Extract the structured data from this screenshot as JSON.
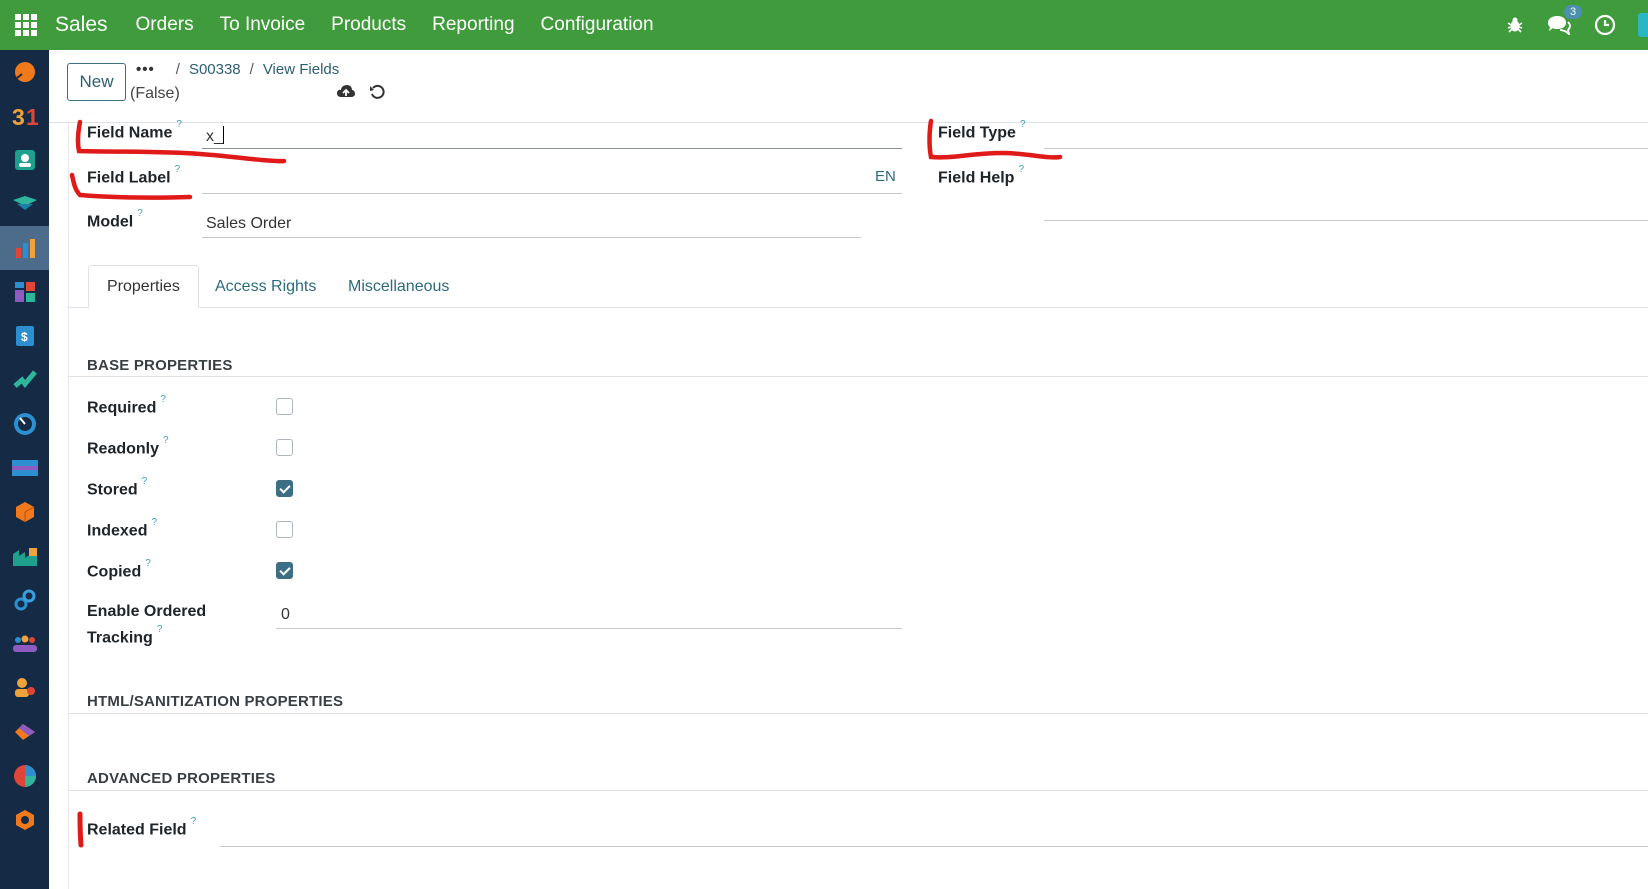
{
  "navbar": {
    "brand": "Sales",
    "menu": [
      "Orders",
      "To Invoice",
      "Products",
      "Reporting",
      "Configuration"
    ],
    "chat_badge": "3",
    "colors": {
      "background": "#3f9b3c"
    }
  },
  "control_panel": {
    "new_label": "New",
    "breadcrumb_dots": "•••",
    "breadcrumb": [
      "S00338",
      "View Fields"
    ],
    "subtitle": "(False)"
  },
  "form": {
    "field_name_label": "Field Name",
    "field_name_value": "x_",
    "field_label_label": "Field Label",
    "field_label_lang": "EN",
    "model_label": "Model",
    "model_value": "Sales Order",
    "field_type_label": "Field Type",
    "field_help_label": "Field Help",
    "help_mark": "?"
  },
  "tabs": [
    "Properties",
    "Access Rights",
    "Miscellaneous"
  ],
  "base_properties": {
    "title": "BASE PROPERTIES",
    "items": [
      {
        "label": "Required",
        "checked": false
      },
      {
        "label": "Readonly",
        "checked": false
      },
      {
        "label": "Stored",
        "checked": true
      },
      {
        "label": "Indexed",
        "checked": false
      },
      {
        "label": "Copied",
        "checked": true
      }
    ],
    "ordered_tracking_label_1": "Enable Ordered",
    "ordered_tracking_label_2": "Tracking",
    "ordered_tracking_value": "0"
  },
  "html_section_title": "HTML/SANITIZATION PROPERTIES",
  "advanced_section_title": "ADVANCED PROPERTIES",
  "related_field_label": "Related Field"
}
